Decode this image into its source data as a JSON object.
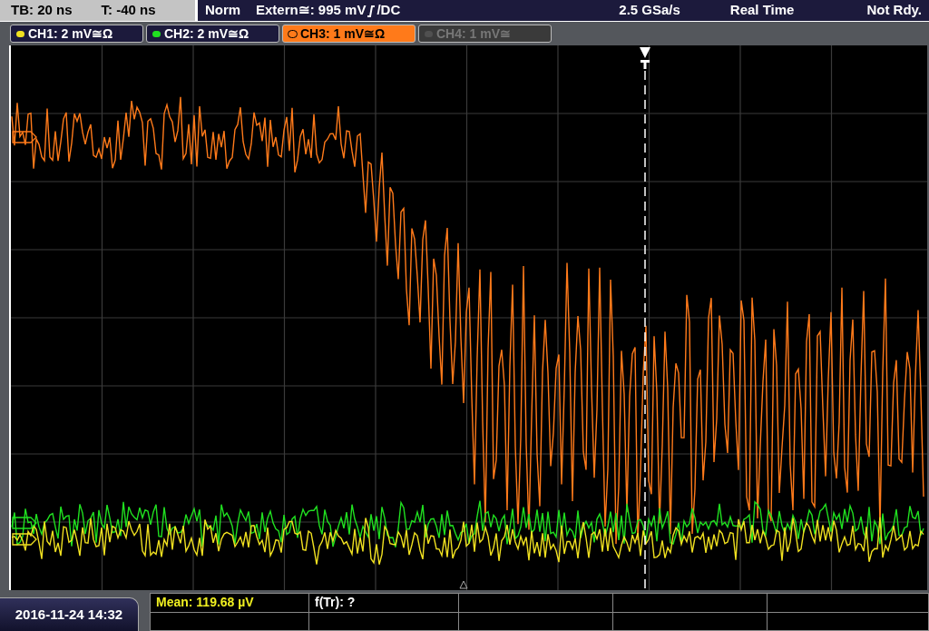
{
  "timebase": {
    "tb": "TB: 20 ns",
    "t": "T: -40 ns"
  },
  "acquisition": {
    "mode": "Norm",
    "trigger": "Extern≅: 995 mV",
    "coupling": "/DC",
    "sample_rate": "2.5 GSa/s",
    "acq_mode": "Real Time",
    "state": "Not Rdy."
  },
  "channels": [
    {
      "label": "CH1: 2 mV≅Ω",
      "color": "#f0e020",
      "selected": false,
      "on": true
    },
    {
      "label": "CH2: 2 mV≅Ω",
      "color": "#20e020",
      "selected": false,
      "on": true
    },
    {
      "label": "CH3: 1 mV≅Ω",
      "color": "#ff7a1a",
      "selected": true,
      "on": true
    },
    {
      "label": "CH4: 1 mV≅",
      "color": "#505050",
      "selected": false,
      "on": false
    }
  ],
  "datetime": "2016-11-24 14:32",
  "measurements": [
    {
      "text": "Mean: 119.68 µV",
      "kind": "highlight"
    },
    {
      "text": "f(Tr): ?",
      "kind": "plain"
    }
  ]
}
